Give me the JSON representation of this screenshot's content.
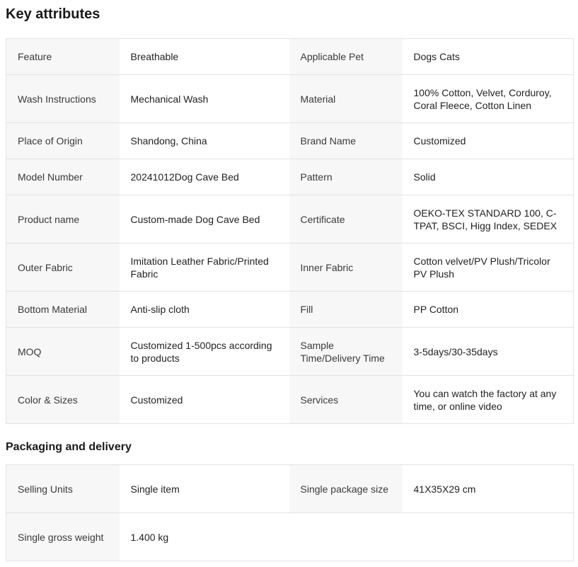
{
  "key_attributes": {
    "title": "Key attributes",
    "rows": [
      {
        "k1": "Feature",
        "v1": "Breathable",
        "k2": "Applicable Pet",
        "v2": "Dogs Cats"
      },
      {
        "k1": "Wash Instructions",
        "v1": "Mechanical Wash",
        "k2": "Material",
        "v2": "100% Cotton, Velvet, Corduroy, Coral Fleece, Cotton Linen"
      },
      {
        "k1": "Place of Origin",
        "v1": "Shandong, China",
        "k2": "Brand Name",
        "v2": "Customized"
      },
      {
        "k1": "Model Number",
        "v1": "20241012Dog Cave Bed",
        "k2": "Pattern",
        "v2": "Solid"
      },
      {
        "k1": "Product name",
        "v1": "Custom-made Dog Cave Bed",
        "k2": "Certificate",
        "v2": "OEKO-TEX STANDARD 100, C-TPAT, BSCI, Higg Index, SEDEX"
      },
      {
        "k1": "Outer Fabric",
        "v1": "Imitation Leather Fabric/Printed Fabric",
        "k2": "Inner Fabric",
        "v2": "Cotton velvet/PV Plush/Tricolor PV Plush"
      },
      {
        "k1": "Bottom Material",
        "v1": "Anti-slip cloth",
        "k2": "Fill",
        "v2": "PP Cotton"
      },
      {
        "k1": "MOQ",
        "v1": "Customized 1-500pcs according to products",
        "k2": "Sample Time/Delivery Time",
        "v2": "3-5days/30-35days"
      },
      {
        "k1": "Color & Sizes",
        "v1": "Customized",
        "k2": "Services",
        "v2": "You can watch the factory at any time, or online video"
      }
    ]
  },
  "packaging": {
    "title": "Packaging and delivery",
    "rows": [
      {
        "k1": "Selling Units",
        "v1": "Single item",
        "k2": "Single package size",
        "v2": "41X35X29 cm"
      },
      {
        "k1": "Single gross weight",
        "v1": "1.400 kg",
        "k2": "",
        "v2": ""
      }
    ]
  }
}
